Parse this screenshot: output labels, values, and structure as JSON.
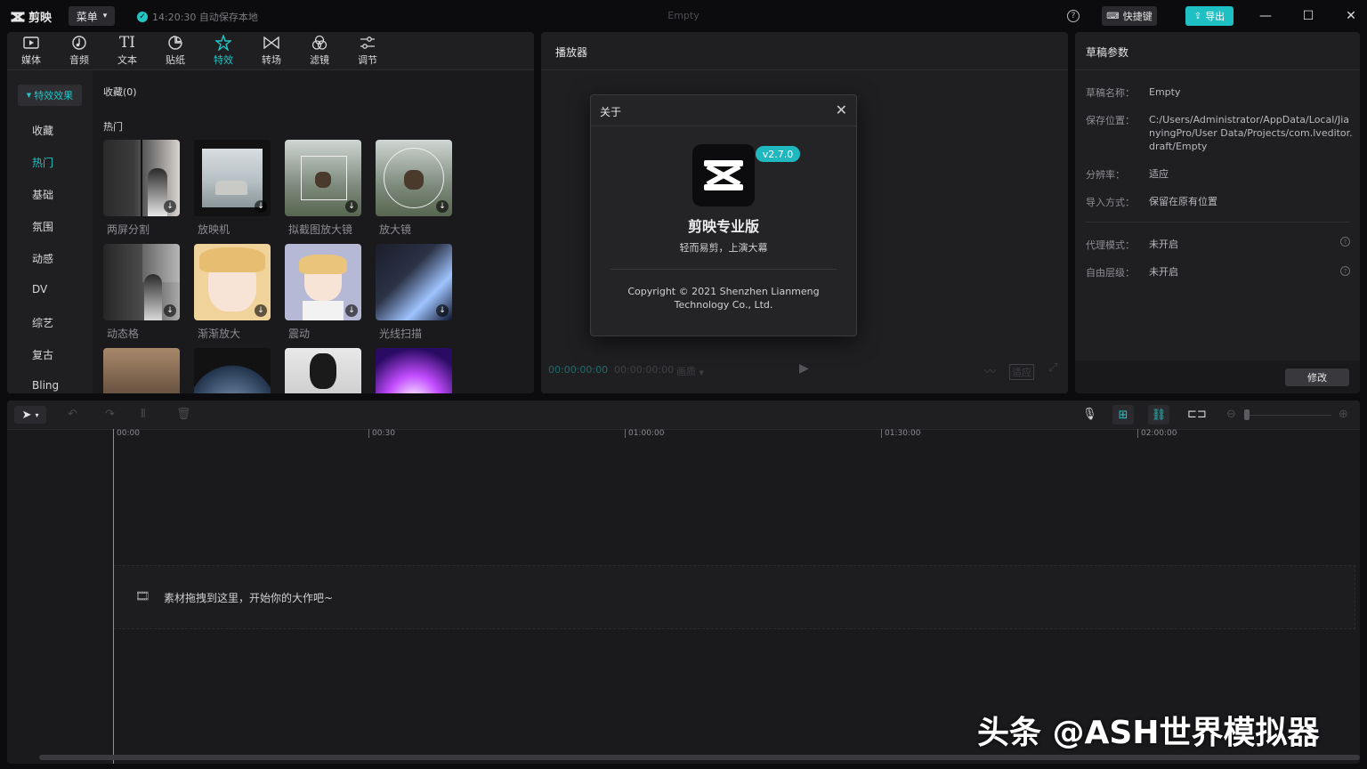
{
  "titlebar": {
    "logo_text": "剪映",
    "menu_label": "菜单",
    "save_status": "14:20:30 自动保存本地",
    "document_title": "Empty",
    "shortcut_label": "快捷键",
    "export_label": "导出",
    "accent": "#1fc0c4"
  },
  "tool_tabs": [
    {
      "label": "媒体",
      "icon": "play-box-icon"
    },
    {
      "label": "音频",
      "icon": "music-note-icon"
    },
    {
      "label": "文本",
      "icon": "text-tool-icon"
    },
    {
      "label": "贴纸",
      "icon": "sticker-icon"
    },
    {
      "label": "特效",
      "icon": "star-effect-icon",
      "active": true
    },
    {
      "label": "转场",
      "icon": "transition-icon"
    },
    {
      "label": "滤镜",
      "icon": "filter-icon"
    },
    {
      "label": "调节",
      "icon": "adjust-sliders-icon"
    }
  ],
  "categories": {
    "header": "特效效果",
    "items": [
      "收藏",
      "热门",
      "基础",
      "氛围",
      "动感",
      "DV",
      "综艺",
      "复古",
      "Bling"
    ],
    "active_index": 1
  },
  "effects": {
    "favorites_label": "收藏(0)",
    "hot_label": "热门",
    "items": [
      "两屏分割",
      "放映机",
      "拟截图放大镜",
      "放大镜",
      "动态格",
      "渐渐放大",
      "震动",
      "光线扫描"
    ]
  },
  "player": {
    "title": "播放器",
    "current_time": "00:00:00:00",
    "total_time": "00:00:00:00",
    "quality": "画质",
    "ratio": "适应"
  },
  "about_dialog": {
    "title": "关于",
    "version": "v2.7.0",
    "app_name": "剪映专业版",
    "slogan": "轻而易剪，上演大幕",
    "copyright_line1": "Copyright © 2021 Shenzhen Lianmeng",
    "copyright_line2": "Technology Co., Ltd."
  },
  "draft": {
    "title": "草稿参数",
    "rows": [
      {
        "label": "草稿名称：",
        "value": "Empty"
      },
      {
        "label": "保存位置：",
        "value_lines": [
          "C:/Users/Administrator/AppData/Local/Jia",
          "nyingPro/User Data/Projects/com.lveditor.",
          "draft/Empty"
        ]
      },
      {
        "label": "分辨率：",
        "value": "适应"
      },
      {
        "label": "导入方式：",
        "value": "保留在原有位置"
      },
      {
        "label": "代理模式：",
        "value": "未开启"
      },
      {
        "label": "自由层级：",
        "value": "未开启"
      }
    ],
    "modify_label": "修改"
  },
  "timeline": {
    "ticks": [
      "00:00",
      "00:30",
      "01:00:00",
      "01:30:00",
      "02:00:00"
    ],
    "drop_hint": "素材拖拽到这里，开始你的大作吧~"
  },
  "watermark": "头条 @ASH世界模拟器"
}
